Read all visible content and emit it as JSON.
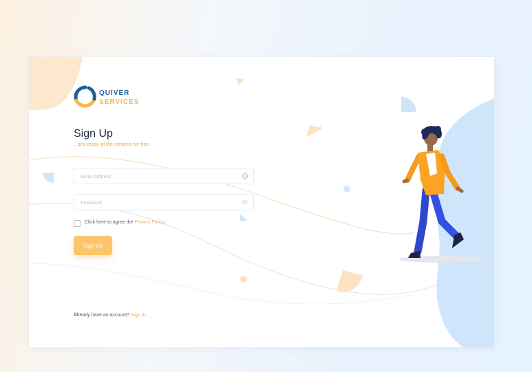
{
  "brand": {
    "line1": "QUIVER",
    "line2": "SERVICES",
    "colors": {
      "blue": "#1f5e97",
      "yellow": "#f6b94a"
    }
  },
  "form": {
    "title": "Sign Up",
    "subtitle": "...and enjoy all the contents for free",
    "email": {
      "placeholder": "Email Address",
      "value": "",
      "icon": "at-icon"
    },
    "password": {
      "placeholder": "Password",
      "value": "",
      "icon": "dots-icon"
    },
    "agree": {
      "prefix": "Click here to agree the ",
      "link": "Privacy Policy",
      "suffix": ".",
      "checked": false
    },
    "submit_label": "Sign Up"
  },
  "footer": {
    "prefix": "Already have an account? ",
    "link": "Sign In",
    "suffix": "."
  },
  "colors": {
    "accent": "#fcc56a",
    "text_dark": "#1f2a3a",
    "blob_blue": "#cfe5fb",
    "blob_peach": "#fde7cd"
  }
}
